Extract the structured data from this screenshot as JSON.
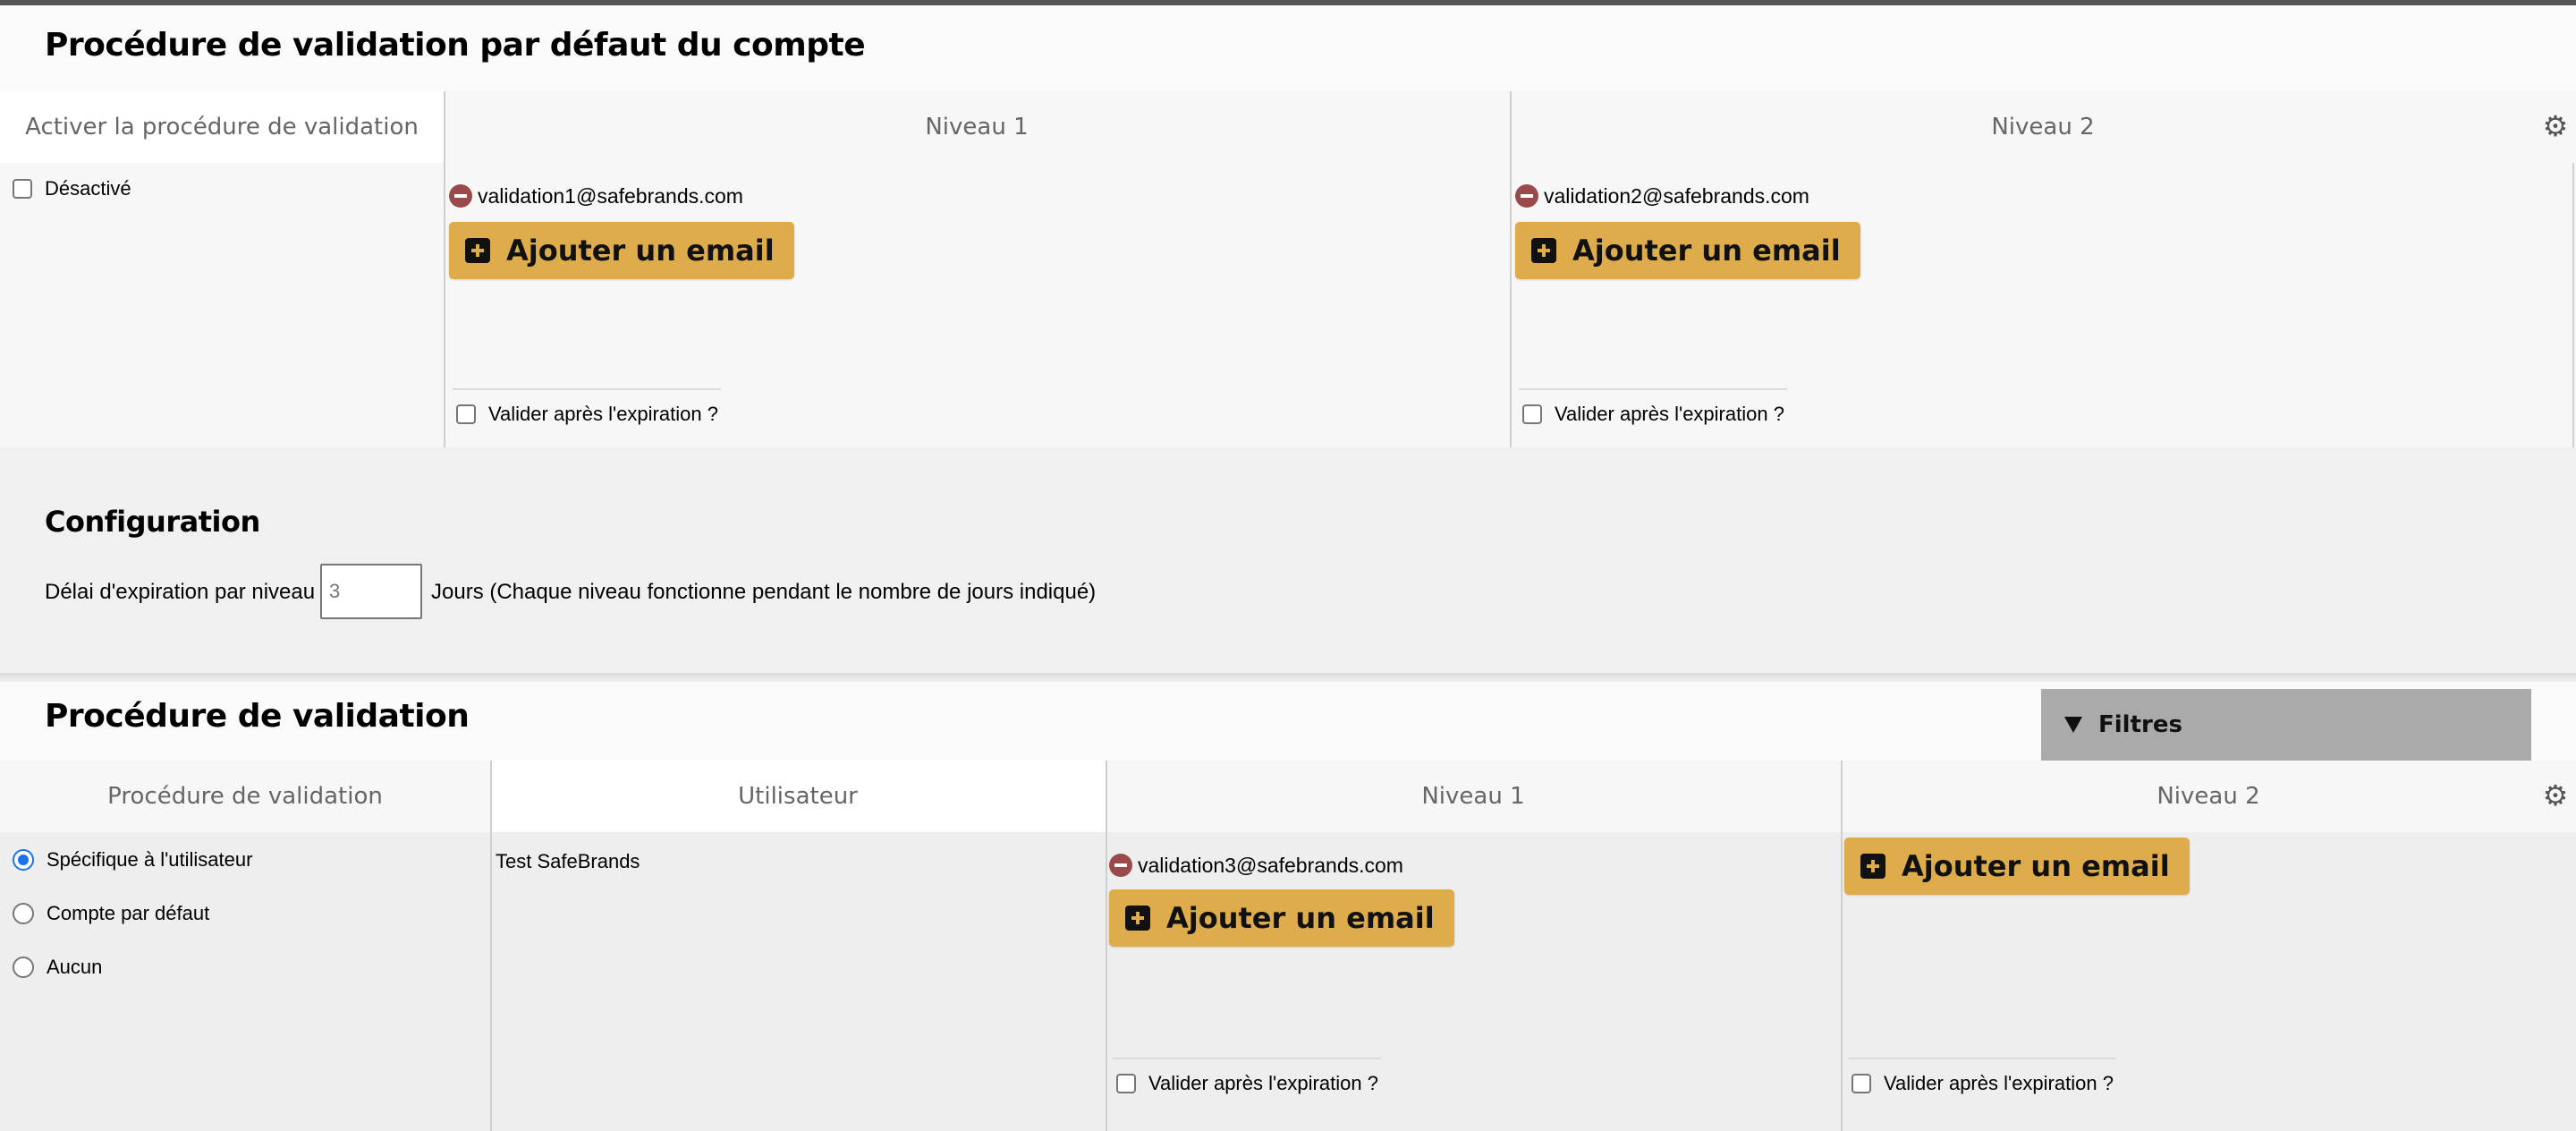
{
  "default_section": {
    "title": "Procédure de validation par défaut du compte",
    "headers": [
      "Activer la procédure de validation",
      "Niveau 1",
      "Niveau 2"
    ],
    "activation": {
      "label": "Désactivé",
      "checked": false
    },
    "level1": {
      "emails": [
        "validation1@safebrands.com"
      ],
      "add_label": "Ajouter un email",
      "expire_label": "Valider après l'expiration ?"
    },
    "level2": {
      "emails": [
        "validation2@safebrands.com"
      ],
      "add_label": "Ajouter un email",
      "expire_label": "Valider après l'expiration ?"
    }
  },
  "configuration": {
    "title": "Configuration",
    "delay_label": "Délai d'expiration par niveau",
    "delay_value": "3",
    "delay_suffix": "Jours (Chaque niveau fonctionne pendant le nombre de jours indiqué)"
  },
  "procedure_section": {
    "title": "Procédure de validation",
    "filters_label": "Filtres",
    "headers": [
      "Procédure de validation",
      "Utilisateur",
      "Niveau 1",
      "Niveau 2"
    ],
    "options": [
      {
        "label": "Spécifique à l'utilisateur",
        "selected": true
      },
      {
        "label": "Compte par défaut",
        "selected": false
      },
      {
        "label": "Aucun",
        "selected": false
      }
    ],
    "user": "Test SafeBrands",
    "level1": {
      "emails": [
        "validation3@safebrands.com"
      ],
      "add_label": "Ajouter un email",
      "expire_label": "Valider après l'expiration ?"
    },
    "level2": {
      "emails": [],
      "add_label": "Ajouter un email",
      "expire_label": "Valider après l'expiration ?"
    }
  },
  "icons": {
    "settings": "gear-icon",
    "remove": "minus-circle-icon",
    "add": "plus-square-icon",
    "filter_toggle": "triangle-down-icon"
  },
  "colors": {
    "accent_button": "#dfac4c",
    "remove_icon": "#9a4a4a",
    "radio_selected": "#1a73e8",
    "filters_bg": "#aaaaaa"
  }
}
